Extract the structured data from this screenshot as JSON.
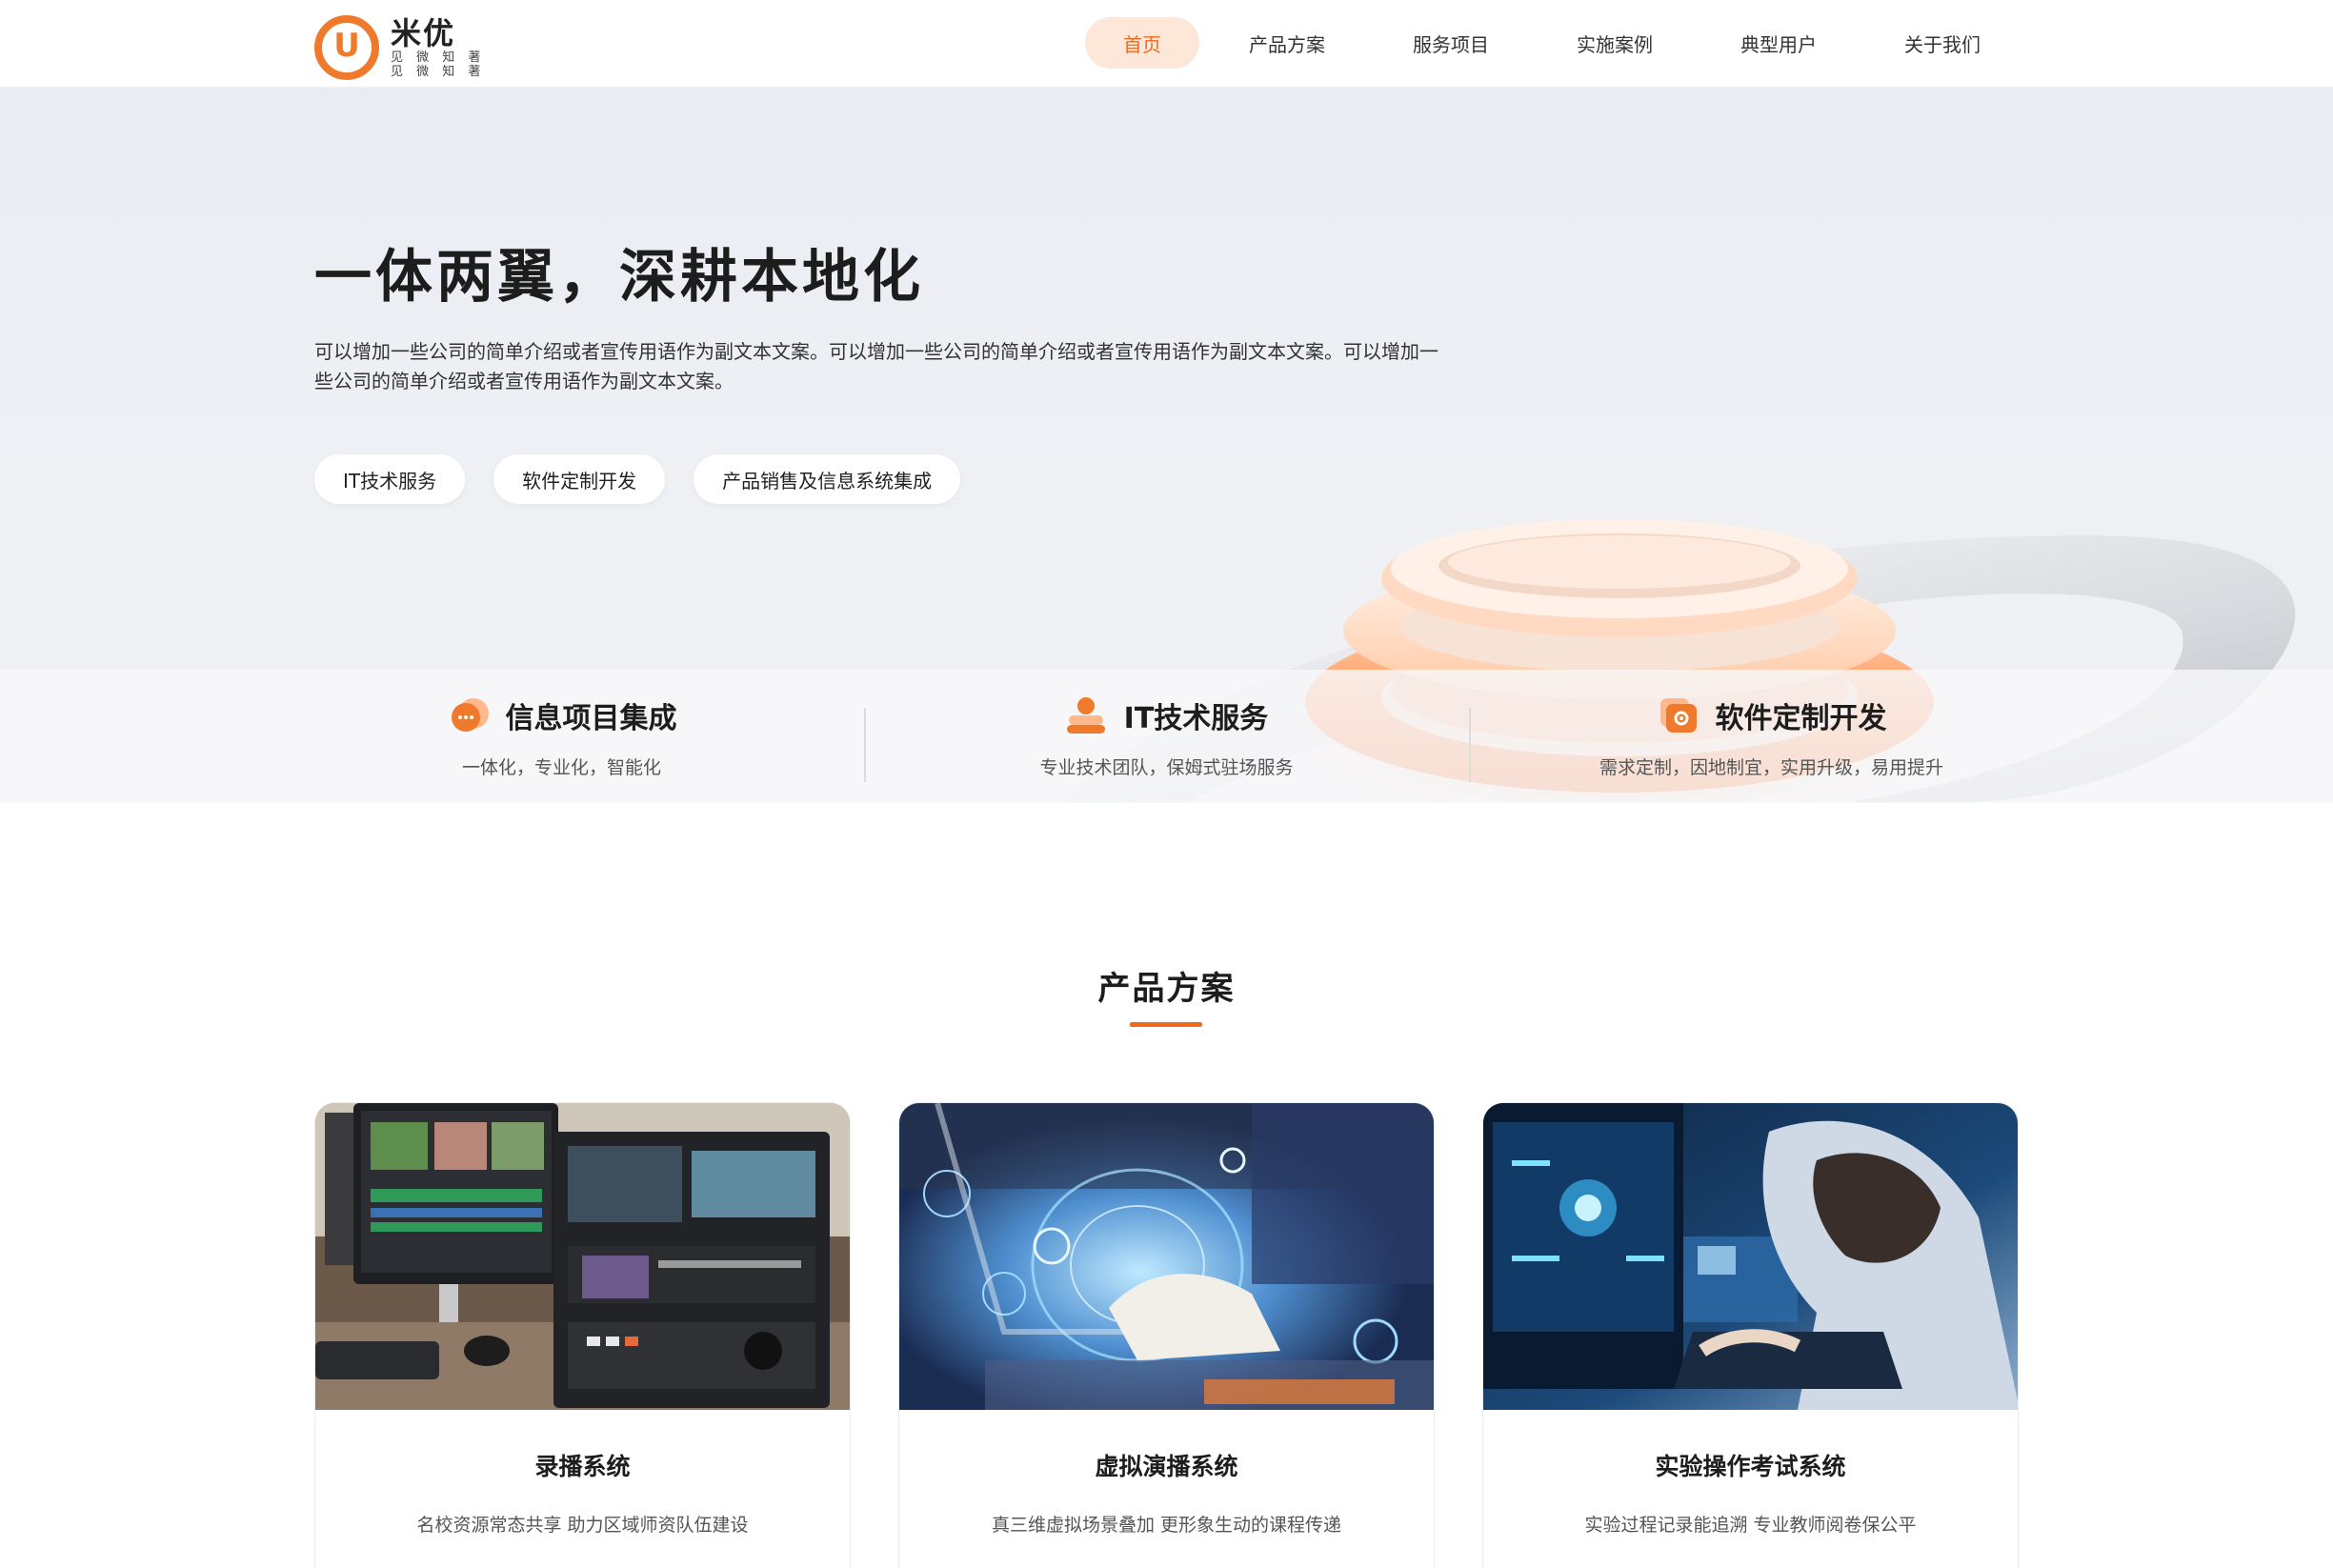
{
  "brand": {
    "name": "米优",
    "tagline_line1": "见 微 知 著",
    "tagline_line2": "见 微 知 著",
    "accent": "#ee6a1d"
  },
  "nav": {
    "items": [
      {
        "label": "首页",
        "active": true
      },
      {
        "label": "产品方案"
      },
      {
        "label": "服务项目"
      },
      {
        "label": "实施案例"
      },
      {
        "label": "典型用户"
      },
      {
        "label": "关于我们"
      }
    ]
  },
  "hero": {
    "title": "一体两翼，深耕本地化",
    "description": "可以增加一些公司的简单介绍或者宣传用语作为副文本文案。可以增加一些公司的简单介绍或者宣传用语作为副文本文案。可以增加一些公司的简单介绍或者宣传用语作为副文本文案。",
    "tags": [
      "IT技术服务",
      "软件定制开发",
      "产品销售及信息系统集成"
    ]
  },
  "features": [
    {
      "icon": "chat-bubble-icon",
      "title": "信息项目集成",
      "subtitle": "一体化，专业化，智能化"
    },
    {
      "icon": "people-icon",
      "title": "IT技术服务",
      "subtitle": "专业技术团队，保姆式驻场服务"
    },
    {
      "icon": "gear-folder-icon",
      "title": "软件定制开发",
      "subtitle": "需求定制，因地制宜，实用升级，易用提升"
    }
  ],
  "products": {
    "section_title": "产品方案",
    "cards": [
      {
        "image": "recording-studio-image",
        "title": "录播系统",
        "description": "名校资源常态共享 助力区域师资队伍建设"
      },
      {
        "image": "virtual-studio-image",
        "title": "虚拟演播系统",
        "description": "真三维虚拟场景叠加 更形象生动的课程传递"
      },
      {
        "image": "lab-exam-image",
        "title": "实验操作考试系统",
        "description": "实验过程记录能追溯 专业教师阅卷保公平"
      }
    ]
  }
}
